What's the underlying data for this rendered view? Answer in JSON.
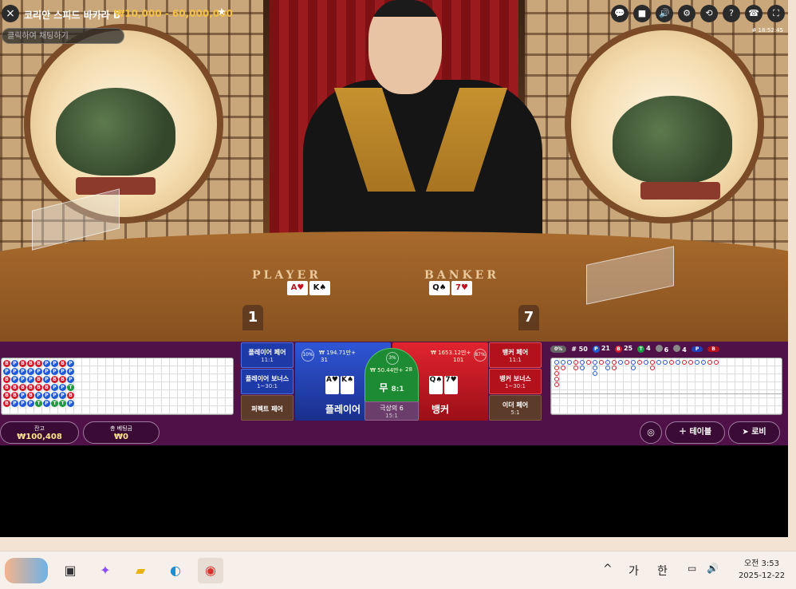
{
  "header": {
    "close_icon": "×",
    "title": "코리안 스피드 바카라 B",
    "limits": "₩10,000 - 60,000,000",
    "favorite_icon": "★",
    "chat_placeholder": "클릭하여 채팅하기",
    "timestamp": "# 18:52:45",
    "icons": [
      "chat-icon",
      "video-icon",
      "volume-icon",
      "settings-icon",
      "history-icon",
      "help-icon",
      "support-icon",
      "fullscreen-icon"
    ],
    "icon_glyphs": [
      "💬",
      "■",
      "🔊",
      "⚙",
      "⟲",
      "?",
      "☎",
      "⛶"
    ]
  },
  "scene": {
    "table_player_word": "PLAYER",
    "table_banker_word": "BANKER",
    "player_cards": [
      "A♥",
      "K♠"
    ],
    "banker_cards": [
      "Q♠",
      "7♥"
    ],
    "player_score": "1",
    "banker_score": "7"
  },
  "betting": {
    "player_pair": {
      "label": "플레이어 페어",
      "odds": "11:1"
    },
    "player_bonus": {
      "label": "플레이어 보너스",
      "odds": "1~30:1"
    },
    "perfect_pair": {
      "label": "퍼펙트 페어"
    },
    "banker_pair": {
      "label": "뱅커 페어",
      "odds": "11:1"
    },
    "banker_bonus": {
      "label": "뱅커 보너스",
      "odds": "1~30:1"
    },
    "either_pair": {
      "label": "이더 페어",
      "odds": "5:1"
    },
    "player": {
      "label": "플레이어",
      "pct": "10%",
      "amount": "₩ 194.71만+",
      "players": "31",
      "cards": [
        "A♥",
        "K♠"
      ]
    },
    "banker": {
      "label": "뱅커",
      "pct": "87%",
      "amount": "₩ 1653.12만+",
      "players": "101",
      "cards": [
        "Q♠",
        "7♥"
      ]
    },
    "tie": {
      "label": "무",
      "odds": "8:1",
      "pct": "3%",
      "amount": "₩ 50.44만+",
      "players": "28"
    },
    "super_six": {
      "label": "극상의 6",
      "odds": "15:1"
    }
  },
  "stats": {
    "hands": "# 50",
    "player_count": "21",
    "banker_count": "25",
    "tie_count": "4",
    "player_pair_count": "6",
    "banker_pair_count": "4",
    "toggle_label": "0%",
    "predict_p": "P",
    "predict_b": "B",
    "p_letter": "P",
    "b_letter": "B",
    "t_letter": "T"
  },
  "bead_road": [
    "B",
    "P",
    "B",
    "B",
    "B",
    "B",
    "P",
    "P",
    "P",
    "B",
    "B",
    "P",
    "B",
    "P",
    "P",
    "B",
    "P",
    "P",
    "B",
    "P",
    "P",
    "B",
    "B",
    "P",
    "B",
    "P",
    "B",
    "B",
    "P",
    "T",
    "P",
    "P",
    "P",
    "B",
    "P",
    "P",
    "P",
    "P",
    "B",
    "P",
    "P",
    "T",
    "B",
    "P",
    "B",
    "P",
    "P",
    "T",
    "P",
    "P",
    "P",
    "T",
    "B",
    "P"
  ],
  "big_road": [
    "P",
    "B",
    "B",
    "B",
    "B",
    "E",
    "P",
    "B",
    "E",
    "E",
    "E",
    "E",
    "P",
    "E",
    "E",
    "E",
    "E",
    "E",
    "B",
    "B",
    "E",
    "E",
    "E",
    "E",
    "P",
    "P",
    "E",
    "E",
    "E",
    "E",
    "B",
    "E",
    "E",
    "E",
    "E",
    "E",
    "P",
    "P",
    "P",
    "E",
    "E",
    "E",
    "B",
    "E",
    "E",
    "E",
    "E",
    "E",
    "P",
    "P",
    "E",
    "E",
    "E",
    "E",
    "B",
    "B",
    "E",
    "E",
    "E",
    "E",
    "P",
    "E",
    "E",
    "E",
    "E",
    "E",
    "B",
    "E",
    "E",
    "E",
    "E",
    "E",
    "P",
    "P",
    "E",
    "E",
    "E",
    "E",
    "B",
    "E",
    "E",
    "E",
    "E",
    "E",
    "P",
    "E",
    "E",
    "E",
    "E",
    "E",
    "B",
    "B",
    "E",
    "E",
    "E",
    "E",
    "P",
    "E",
    "E",
    "E",
    "E",
    "E",
    "P",
    "E",
    "E",
    "E",
    "E",
    "E",
    "B",
    "E",
    "E",
    "E",
    "E",
    "E",
    "P",
    "E",
    "E",
    "E",
    "E",
    "E",
    "B",
    "E",
    "E",
    "E",
    "E",
    "E",
    "B",
    "E",
    "E",
    "E",
    "E",
    "E",
    "P",
    "E",
    "E",
    "E",
    "E",
    "E",
    "P",
    "E",
    "E",
    "E",
    "E",
    "E",
    "B",
    "E",
    "E",
    "E",
    "E",
    "E",
    "B",
    "E",
    "E",
    "E",
    "E",
    "E"
  ],
  "footer": {
    "balance_label": "잔고",
    "balance_value": "₩100,408",
    "total_bet_label": "총 베팅금",
    "total_bet_value": "₩0",
    "table_button": "테이블",
    "lobby_button": "로비"
  },
  "taskbar": {
    "tray_chevron": "^",
    "ime_1": "가",
    "ime_2": "한",
    "time": "오전 3:53",
    "date": "2025-12-22"
  }
}
